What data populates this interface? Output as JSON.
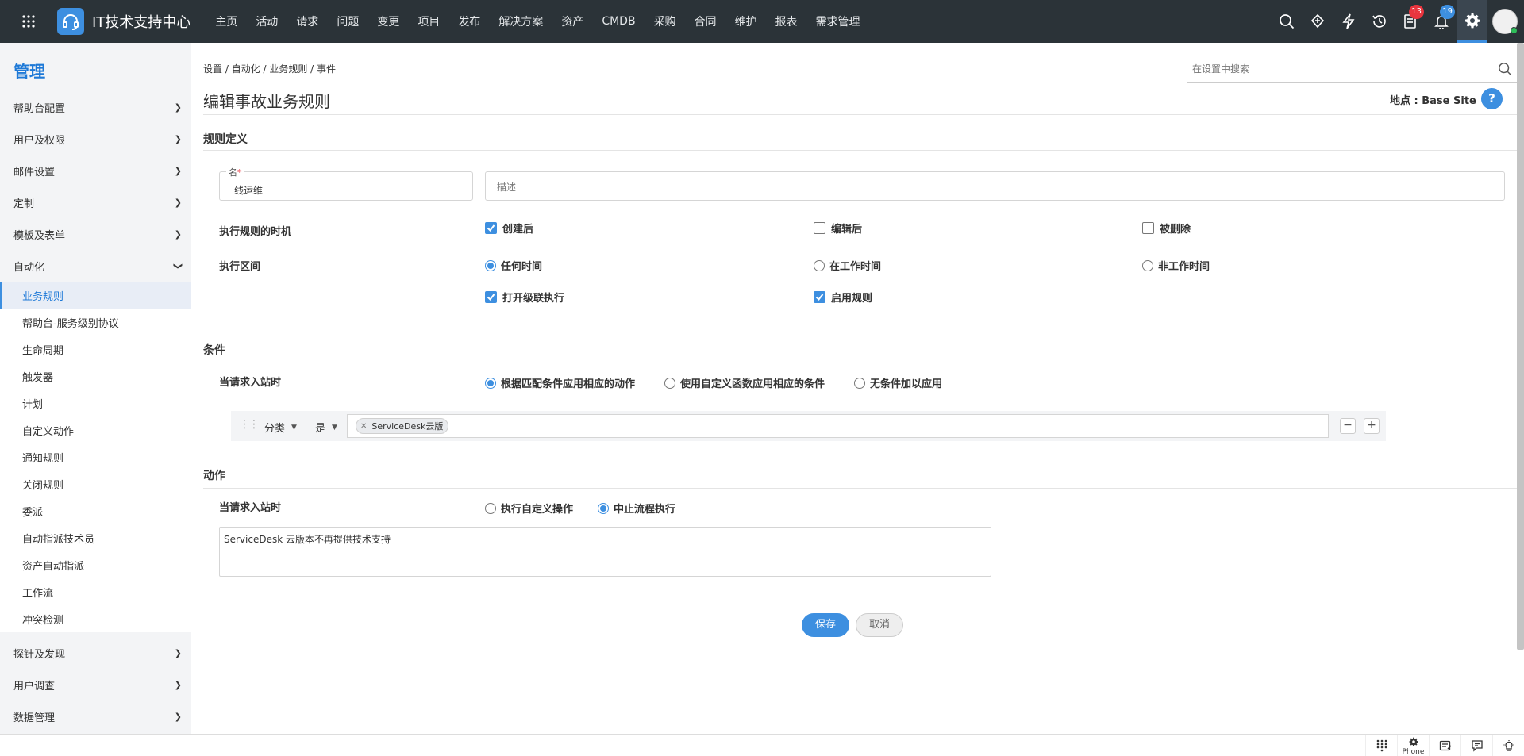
{
  "topbar": {
    "brand": "IT技术支持中心",
    "nav": [
      "主页",
      "活动",
      "请求",
      "问题",
      "变更",
      "项目",
      "发布",
      "解决方案",
      "资产",
      "CMDB",
      "采购",
      "合同",
      "维护",
      "报表",
      "需求管理"
    ],
    "badges": {
      "tasks": "13",
      "notifications": "19"
    }
  },
  "sidebar": {
    "title": "管理",
    "groups_top": [
      "帮助台配置",
      "用户及权限",
      "邮件设置",
      "定制",
      "模板及表单"
    ],
    "automation": "自动化",
    "automation_items": [
      "业务规则",
      "帮助台-服务级别协议",
      "生命周期",
      "触发器",
      "计划",
      "自定义动作",
      "通知规则",
      "关闭规则",
      "委派",
      "自动指派技术员",
      "资产自动指派",
      "工作流",
      "冲突检测"
    ],
    "groups_bottom": [
      "探针及发现",
      "用户调查",
      "数据管理"
    ]
  },
  "header": {
    "breadcrumb": "设置 / 自动化 / 业务规则 / 事件",
    "title": "编辑事故业务规则",
    "search_placeholder": "在设置中搜索",
    "site": "地点 : Base Site",
    "help": "?"
  },
  "rule_definition": {
    "section_title": "规则定义",
    "name_label": "名",
    "name_required": "*",
    "name_value": "一线运维",
    "description_placeholder": "描述",
    "timing_label": "执行规则的时机",
    "timing_options": [
      {
        "label": "创建后",
        "checked": true
      },
      {
        "label": "编辑后",
        "checked": false
      },
      {
        "label": "被删除",
        "checked": false
      }
    ],
    "window_label": "执行区间",
    "window_options": [
      {
        "label": "任何时间",
        "selected": true
      },
      {
        "label": "在工作时间",
        "selected": false
      },
      {
        "label": "非工作时间",
        "selected": false
      }
    ],
    "cascade": {
      "label": "打开级联执行",
      "checked": true
    },
    "enable": {
      "label": "启用规则",
      "checked": true
    }
  },
  "conditions": {
    "section_title": "条件",
    "when_label": "当请求入站时",
    "modes": [
      {
        "label": "根据匹配条件应用相应的动作",
        "selected": true
      },
      {
        "label": "使用自定义函数应用相应的条件",
        "selected": false
      },
      {
        "label": "无条件加以应用",
        "selected": false
      }
    ],
    "row": {
      "field": "分类",
      "operator": "是",
      "value": "ServiceDesk云版"
    }
  },
  "actions": {
    "section_title": "动作",
    "when_label": "当请求入站时",
    "options": [
      {
        "label": "执行自定义操作",
        "selected": false
      },
      {
        "label": "中止流程执行",
        "selected": true
      }
    ],
    "message": "ServiceDesk 云版本不再提供技术支持"
  },
  "buttons": {
    "save": "保存",
    "cancel": "取消"
  },
  "bottombar": {
    "phone": "Phone"
  }
}
